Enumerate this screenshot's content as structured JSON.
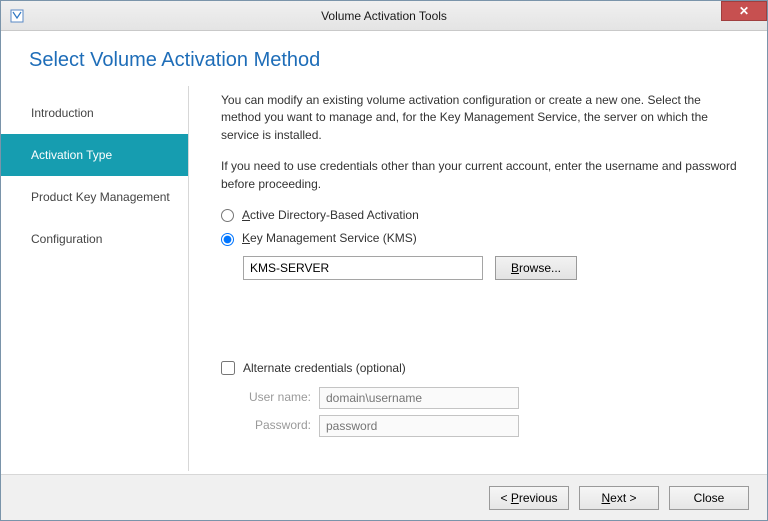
{
  "window": {
    "title": "Volume Activation Tools"
  },
  "heading": "Select Volume Activation Method",
  "sidebar": {
    "items": [
      {
        "label": "Introduction",
        "selected": false
      },
      {
        "label": "Activation Type",
        "selected": true
      },
      {
        "label": "Product Key Management",
        "selected": false
      },
      {
        "label": "Configuration",
        "selected": false
      }
    ]
  },
  "content": {
    "para1": "You can modify an existing volume activation configuration or create a new one. Select the method you want to manage and, for the Key Management Service, the server on which the service is installed.",
    "para2": "If you need to use credentials other than your current account, enter the username and password before proceeding.",
    "radio_ad": {
      "prefix": "A",
      "rest": "ctive Directory-Based Activation",
      "checked": false
    },
    "radio_kms": {
      "prefix": "K",
      "rest": "ey Management Service (KMS)",
      "checked": true
    },
    "server_value": "KMS-SERVER",
    "browse": {
      "prefix": "B",
      "rest": "rowse..."
    },
    "alt_creds": {
      "label": "Alternate credentials (optional)",
      "checked": false
    },
    "username": {
      "label": "User name:",
      "placeholder": "domain\\username",
      "value": ""
    },
    "password": {
      "label": "Password:",
      "placeholder": "password",
      "value": ""
    }
  },
  "footer": {
    "previous": {
      "prefix": "P",
      "rest": "revious"
    },
    "next": {
      "prefix": "N",
      "rest": "ext >"
    },
    "close": {
      "label": "Close"
    }
  }
}
